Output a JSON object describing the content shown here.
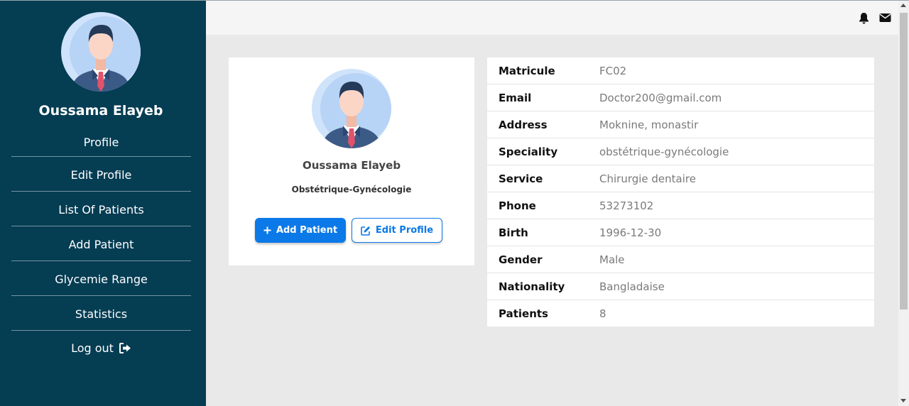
{
  "user": {
    "name": "Oussama Elayeb",
    "speciality_title": "Obstétrique-Gynécologie"
  },
  "sidebar": {
    "items": [
      {
        "label": "Profile"
      },
      {
        "label": "Edit Profile"
      },
      {
        "label": "List Of Patients"
      },
      {
        "label": "Add Patient"
      },
      {
        "label": "Glycemie Range"
      },
      {
        "label": "Statistics"
      }
    ],
    "logout_label": "Log out"
  },
  "topbar": {
    "icons": [
      "bell-icon",
      "envelope-icon"
    ]
  },
  "card": {
    "add_patient_label": "Add Patient",
    "edit_profile_label": "Edit Profile"
  },
  "details": [
    {
      "key": "Matricule",
      "value": "FC02"
    },
    {
      "key": "Email",
      "value": "Doctor200@gmail.com"
    },
    {
      "key": "Address",
      "value": "Moknine, monastir"
    },
    {
      "key": "Speciality",
      "value": "obstétrique-gynécologie"
    },
    {
      "key": "Service",
      "value": "Chirurgie dentaire"
    },
    {
      "key": "Phone",
      "value": "53273102"
    },
    {
      "key": "Birth",
      "value": "1996-12-30"
    },
    {
      "key": "Gender",
      "value": "Male"
    },
    {
      "key": "Nationality",
      "value": "Bangladaise"
    },
    {
      "key": "Patients",
      "value": "8"
    }
  ],
  "colors": {
    "sidebar_bg": "#053d53",
    "accent": "#0b79e8",
    "content_bg": "#e9e9e9"
  }
}
